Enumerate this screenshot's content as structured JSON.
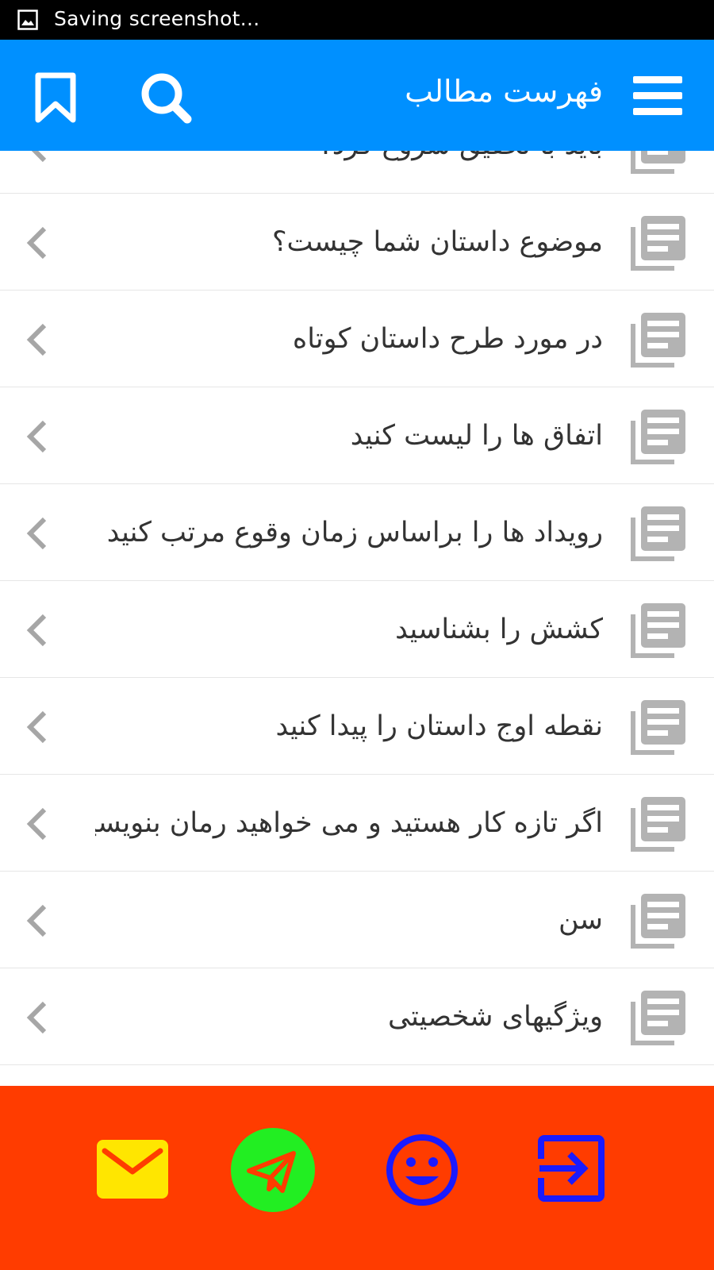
{
  "status_bar": {
    "text": "Saving screenshot...",
    "icon": "image-icon"
  },
  "app_bar": {
    "title": "فهرست مطالب",
    "icons": [
      "menu-icon",
      "search-icon",
      "bookmark-icon"
    ],
    "color": "#0090ff"
  },
  "list": {
    "items": [
      {
        "label": "باید با تحقیق شروع کرد؟"
      },
      {
        "label": "موضوع داستان شما چیست؟"
      },
      {
        "label": "در مورد طرح داستان کوتاه"
      },
      {
        "label": "اتفاق ها را لیست کنید"
      },
      {
        "label": "رویداد ها را براساس زمان وقوع مرتب کنید"
      },
      {
        "label": "کشش را بشناسید"
      },
      {
        "label": "نقطه اوج داستان را پیدا کنید"
      },
      {
        "label": "اگر تازه کار هستید و می خواهید رمان بنویسید"
      },
      {
        "label": "سن"
      },
      {
        "label": "ویژگیهای شخصیتی"
      }
    ],
    "item_icon": "document-icon",
    "chevron_icon": "chevron-left-icon"
  },
  "bottom_bar": {
    "color": "#ff3c00",
    "buttons": [
      {
        "icon": "mail-icon",
        "color": "#ffe600"
      },
      {
        "icon": "telegram-icon",
        "color": "#22ee22"
      },
      {
        "icon": "smile-icon",
        "color": "#1a1aff"
      },
      {
        "icon": "login-icon",
        "color": "#1a1aff"
      }
    ]
  }
}
